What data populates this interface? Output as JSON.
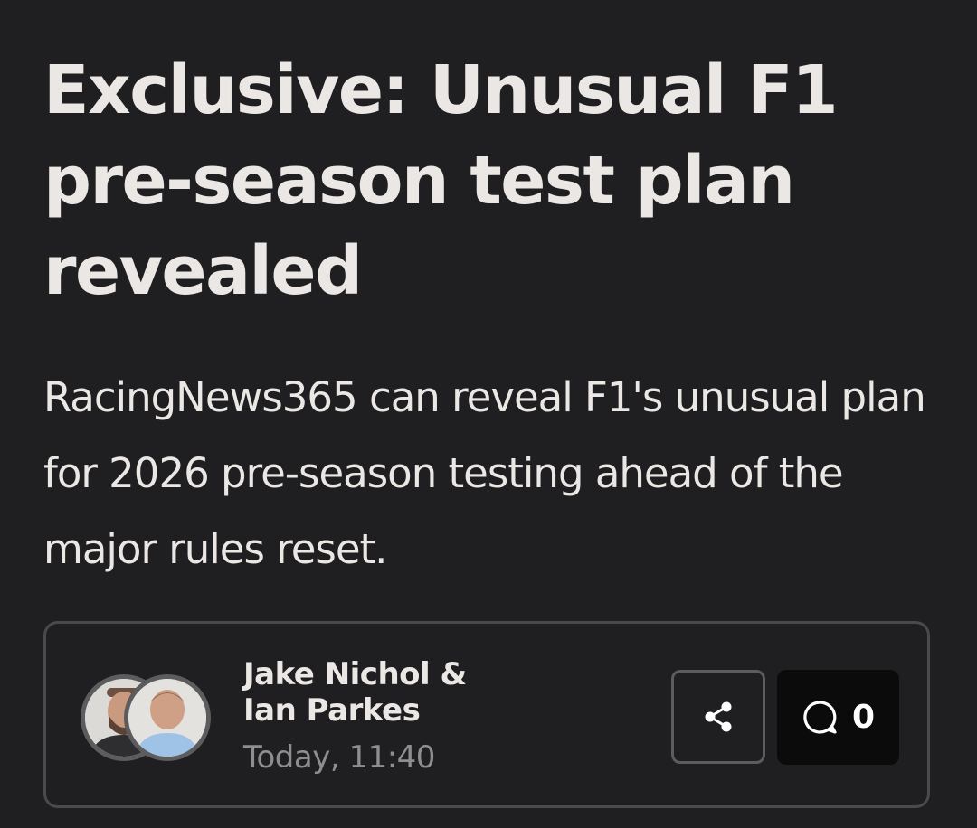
{
  "article": {
    "headline": "Exclusive: Unusual F1 pre-season test plan revealed",
    "standfirst": "RacingNews365 can reveal F1's unusual plan for 2026 pre-season testing ahead of the major rules reset."
  },
  "byline": {
    "authors": "Jake Nichol & Ian Parkes",
    "timestamp": "Today, 11:40",
    "avatars": [
      "avatar-jake-nichol",
      "avatar-ian-parkes"
    ]
  },
  "actions": {
    "share_icon": "share-icon",
    "comments_icon": "comment-bubble-icon",
    "comments_count": "0"
  },
  "colors": {
    "background": "#1f1f21",
    "text": "#ebe7e4",
    "muted_text": "#8e8e90",
    "card_border": "#4a4a4d",
    "comments_button_bg": "#0b0b0c"
  }
}
